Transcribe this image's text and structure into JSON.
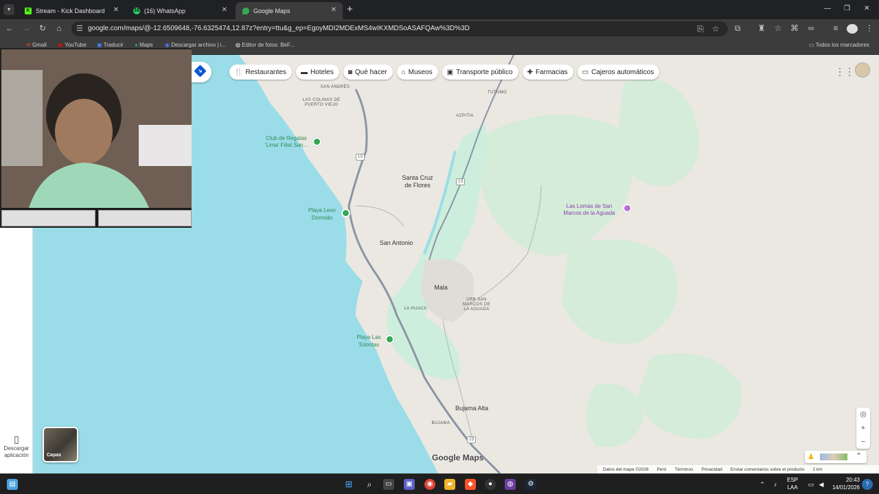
{
  "browser": {
    "tabs": [
      {
        "title": "Stream - Kick Dashboard",
        "favicon": "kick-icon",
        "color": "#53fc18"
      },
      {
        "title": "(16) WhatsApp",
        "favicon": "whatsapp-icon",
        "color": "#25d366",
        "badge": "16"
      },
      {
        "title": "Google Maps",
        "favicon": "maps-icon",
        "color": "#34a853"
      }
    ],
    "active_tab": 2,
    "url": "google.com/maps/@-12.6509648,-76.6325474,12.87z?entry=ttu&g_ep=EgoyMDI2MDExMS4wIKXMDSoASAFQAw%3D%3D",
    "bookmarks": [
      {
        "label": "Gmail",
        "icon": "gmail-icon"
      },
      {
        "label": "YouTube",
        "icon": "youtube-icon"
      },
      {
        "label": "Traducir",
        "icon": "translate-icon"
      },
      {
        "label": "Maps",
        "icon": "maps-icon"
      },
      {
        "label": "Descargar archivo | i...",
        "icon": "download-icon"
      },
      {
        "label": "Editor de fotos: BeF...",
        "icon": "befunky-icon"
      }
    ],
    "all_bookmarks": "Todos los marcadores"
  },
  "maps": {
    "chips": [
      {
        "label": "Restaurantes",
        "icon": "fork-knife-icon"
      },
      {
        "label": "Hoteles",
        "icon": "bed-icon"
      },
      {
        "label": "Qué hacer",
        "icon": "camera-icon"
      },
      {
        "label": "Museos",
        "icon": "museum-icon"
      },
      {
        "label": "Transporte público",
        "icon": "train-icon"
      },
      {
        "label": "Farmacias",
        "icon": "pharmacy-icon"
      },
      {
        "label": "Cajeros automáticos",
        "icon": "atm-icon"
      }
    ],
    "download_app": "Descargar aplicación",
    "layers": "Capas",
    "logo": "Google Maps",
    "places": {
      "san_andres": "SAN ANDRÉS",
      "tutumo": "TUTUMO",
      "colinas_1": "LAS COLINAS DE",
      "colinas_2": "PUERTO VIEJO",
      "azpitia": "AZPITIA",
      "regatas_1": "Club de Regatas",
      "regatas_2": "'Lima' Filial San...",
      "santa_cruz_1": "Santa Cruz",
      "santa_cruz_2": "de Flores",
      "lomas_1": "Las Lomas de San",
      "lomas_2": "Marcos de la Aguada",
      "playa_leon_1": "Playa Leon",
      "playa_leon_2": "Dormido",
      "san_antonio": "San Antonio",
      "mala": "Mala",
      "urb_1": "URB SAN",
      "urb_2": "MARCOS DE",
      "urb_3": "LA AGUADA",
      "la_huaca": "LA HUACA",
      "tortoritas_1": "Playa Las",
      "tortoritas_2": "Totoritas",
      "bujama_alta": "Bujama Alta",
      "bujama": "BUJAMA"
    },
    "route_shield": "1S",
    "attribution": [
      "Datos del mapa ©2026",
      "Perú",
      "Términos",
      "Privacidad",
      "Enviar comentarios sobre el producto",
      "2 km"
    ]
  },
  "taskbar": {
    "lang_1": "ESP",
    "lang_2": "LAA",
    "time": "20:43",
    "date": "14/01/2026"
  },
  "colors": {
    "water": "#9adde8",
    "land": "#ebe8e1",
    "green": "#c9ecd9",
    "road": "#8a94a6"
  }
}
